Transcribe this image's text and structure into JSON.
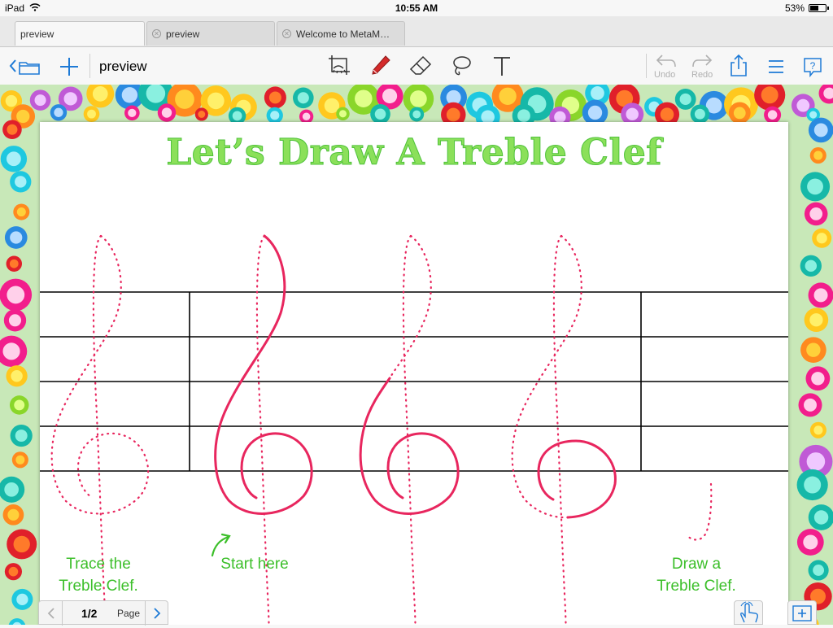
{
  "status_bar": {
    "device": "iPad",
    "time": "10:55 AM",
    "battery": "53%",
    "battery_level": 0.53
  },
  "tabs": [
    {
      "label": "preview",
      "active": true
    },
    {
      "label": "preview",
      "active": false
    },
    {
      "label": "Welcome to MetaM…",
      "active": false
    }
  ],
  "toolbar": {
    "title": "preview",
    "undo_label": "Undo",
    "redo_label": "Redo",
    "icons": [
      "back-folder-icon",
      "add-icon",
      "screenshot-tool-icon",
      "pen-icon",
      "eraser-icon",
      "lasso-icon",
      "text-tool-icon",
      "undo-icon",
      "redo-icon",
      "share-icon",
      "list-icon",
      "help-icon"
    ]
  },
  "document": {
    "title": "Let’s Draw A Treble Clef",
    "captions": {
      "trace": "Trace the\nTreble Clef.",
      "start": "Start here",
      "draw": "Draw a\nTreble Clef."
    }
  },
  "page_nav": {
    "page": "1/2",
    "label": "Page"
  },
  "colors": {
    "accent": "#1e7ad6",
    "title_green": "#8be05a",
    "caption_green": "#3cbf2a",
    "clef_pink": "#e8265e"
  }
}
